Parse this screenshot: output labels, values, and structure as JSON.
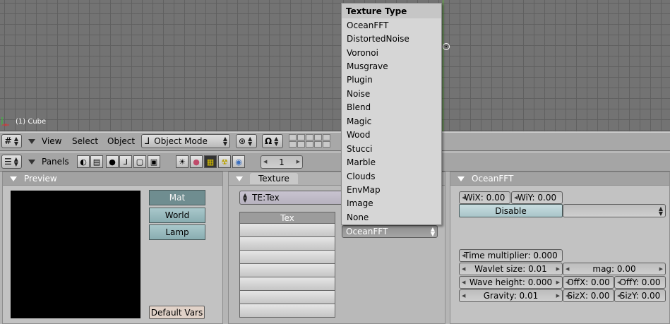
{
  "viewport": {
    "object_label": "(1) Cube"
  },
  "header1": {
    "view": "View",
    "select": "Select",
    "object": "Object",
    "mode": "Object Mode"
  },
  "header2": {
    "panels": "Panels",
    "frame": "1"
  },
  "preview": {
    "title": "Preview",
    "buttons": [
      "Mat",
      "World",
      "Lamp"
    ],
    "default_vars": "Default Vars"
  },
  "texture": {
    "tab": "Texture",
    "te_name": "TE:Tex",
    "tex_header": "Tex",
    "type_value": "OceanFFT"
  },
  "menu": {
    "title": "Texture Type",
    "items": [
      "OceanFFT",
      "DistortedNoise",
      "Voronoi",
      "Musgrave",
      "Plugin",
      "Noise",
      "Blend",
      "Magic",
      "Wood",
      "Stucci",
      "Marble",
      "Clouds",
      "EnvMap",
      "Image",
      "None"
    ]
  },
  "ocean": {
    "title": "OceanFFT",
    "wix": "WiX: 0.00",
    "wiy": "WiY: 0.00",
    "disable": "Disable",
    "time_multiplier": "Time multiplier: 0.000",
    "wavlet_size": "Wavlet size: 0.01",
    "mag": "mag: 0.00",
    "wave_height": "Wave height: 0.000",
    "offx": "OffX: 0.00",
    "offy": "OffY: 0.00",
    "gravity": "Gravity: 0.01",
    "sizx": "SizX: 0.00",
    "sizy": "SizY: 0.00"
  }
}
